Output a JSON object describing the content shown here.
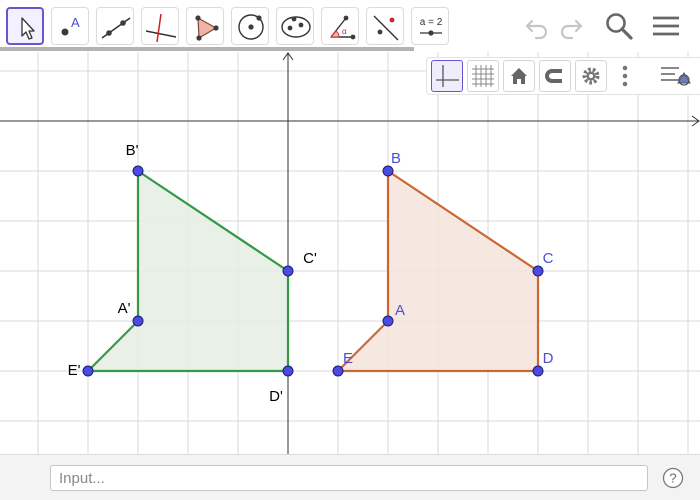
{
  "toolbar": {
    "tools": [
      {
        "icon": "move-arrow-icon",
        "selected": true
      },
      {
        "icon": "point-icon",
        "label": "A"
      },
      {
        "icon": "line-icon"
      },
      {
        "icon": "perpendicular-line-icon"
      },
      {
        "icon": "polygon-icon"
      },
      {
        "icon": "circle-with-center-icon"
      },
      {
        "icon": "ellipse-icon"
      },
      {
        "icon": "angle-icon",
        "label": "α"
      },
      {
        "icon": "reflect-about-line-icon"
      },
      {
        "icon": "slider-icon",
        "label": "a = 2"
      }
    ],
    "right_icons": [
      "undo-icon",
      "redo-icon",
      "search-icon",
      "menu-icon"
    ]
  },
  "style_bar": {
    "buttons": [
      "show-axes-icon",
      "show-grid-icon",
      "standard-view-icon",
      "point-capturing-icon",
      "settings-gear-icon",
      "more-vertical-icon",
      "toggle-algebra-view-icon"
    ],
    "active": [
      "show-axes-icon"
    ]
  },
  "polygons": {
    "original": {
      "color": "#cc6633",
      "fill": "#f4e4dc",
      "label_color": "#4d4fd6",
      "points": [
        {
          "name": "A",
          "x": 2,
          "y": -4
        },
        {
          "name": "B",
          "x": 2,
          "y": -1
        },
        {
          "name": "C",
          "x": 5,
          "y": -3
        },
        {
          "name": "D",
          "x": 5,
          "y": -5
        },
        {
          "name": "E",
          "x": 1,
          "y": -5
        }
      ]
    },
    "image": {
      "color": "#339944",
      "fill": "#e4ede4",
      "label_color": "#000000",
      "points": [
        {
          "name": "A'",
          "x": -3,
          "y": -4
        },
        {
          "name": "B'",
          "x": -3,
          "y": -1
        },
        {
          "name": "C'",
          "x": 0,
          "y": -3
        },
        {
          "name": "D'",
          "x": 0,
          "y": -5
        },
        {
          "name": "E'",
          "x": -4,
          "y": -5
        }
      ]
    },
    "point_color": "#4b4be0"
  },
  "input_bar": {
    "placeholder": "Input..."
  },
  "help": {
    "label": "?"
  }
}
